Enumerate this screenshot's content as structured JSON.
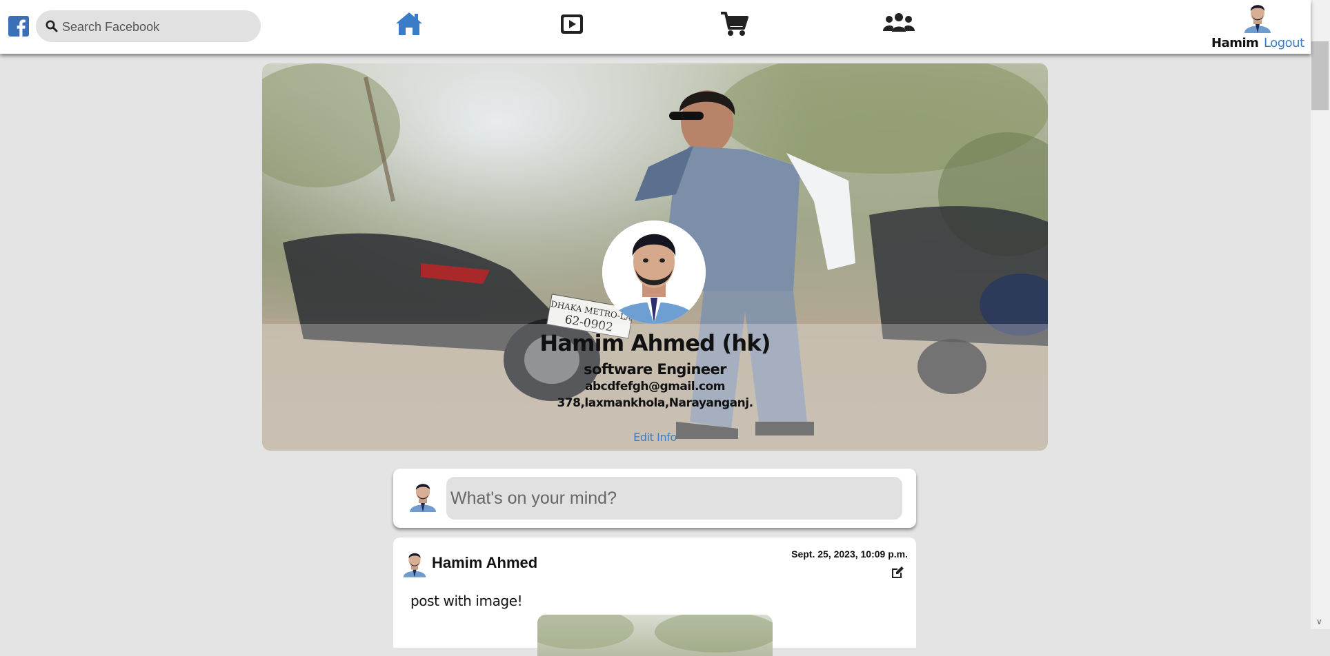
{
  "search": {
    "placeholder": "Search Facebook"
  },
  "nav": {
    "icons": [
      "home-icon",
      "video-icon",
      "cart-icon",
      "groups-icon"
    ],
    "accent": "#3b6fb6"
  },
  "user": {
    "name": "Hamim",
    "logout_label": "Logout"
  },
  "profile": {
    "name": "Hamim Ahmed (hk)",
    "title": "software Engineer",
    "email": "abcdfefgh@gmail.com",
    "address": "378,laxmankhola,Narayanganj.",
    "edit_label": "Edit Info",
    "cover_plate_text": "DHAKA METRO-LA 62-0902"
  },
  "composer": {
    "placeholder": "What's on your mind?"
  },
  "post": {
    "author": "Hamim Ahmed",
    "time": "Sept. 25, 2023, 10:09 p.m.",
    "text": "post with image!"
  },
  "colors": {
    "link": "#3b7cc7",
    "background": "#e4e4e4",
    "logo": "#3b6fb6"
  }
}
